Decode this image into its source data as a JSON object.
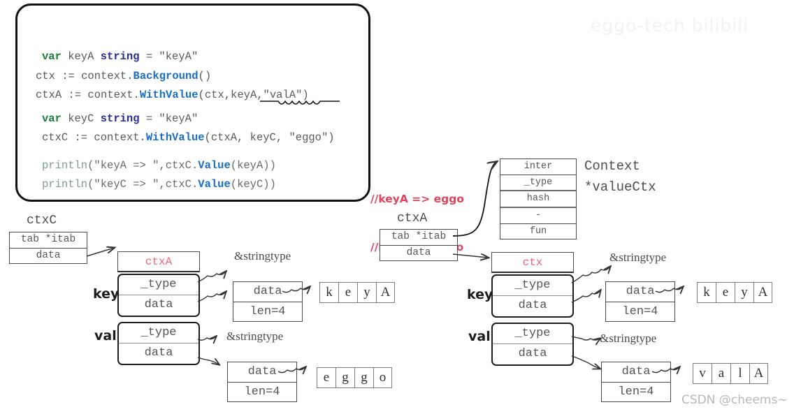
{
  "watermarks": {
    "top": "eggo-tech bilibili",
    "bottom": "CSDN @cheems~"
  },
  "code": {
    "lines": [
      {
        "parts": [
          {
            "t": "var",
            "c": "kw"
          },
          {
            "t": " keyA ",
            "c": ""
          },
          {
            "t": "string",
            "c": "ty"
          },
          {
            "t": " = \"keyA\"",
            "c": ""
          }
        ],
        "indent": true
      },
      {
        "parts": [
          {
            "t": "ctx := context.",
            "c": ""
          },
          {
            "t": "Background",
            "c": "fn"
          },
          {
            "t": "()",
            "c": ""
          }
        ],
        "indent": false
      },
      {
        "parts": [
          {
            "t": "ctxA := context.",
            "c": ""
          },
          {
            "t": "WithValue",
            "c": "fn"
          },
          {
            "t": "(ctx,keyA,\"valA\")",
            "c": ""
          }
        ],
        "indent": false
      },
      {
        "parts": [
          {
            "t": "var",
            "c": "kw"
          },
          {
            "t": " keyC ",
            "c": ""
          },
          {
            "t": "string",
            "c": "ty"
          },
          {
            "t": " = \"keyA\"",
            "c": ""
          }
        ],
        "indent": true
      },
      {
        "parts": [
          {
            "t": "ctxC := context.",
            "c": ""
          },
          {
            "t": "WithValue",
            "c": "fn"
          },
          {
            "t": "(ctxA, keyC, \"eggo\")",
            "c": ""
          }
        ],
        "indent": true
      },
      {
        "parts": [
          {
            "t": "println",
            "c": "pl"
          },
          {
            "t": "(\"keyA => \",ctxC.",
            "c": "pt"
          },
          {
            "t": "Value",
            "c": "fn"
          },
          {
            "t": "(keyA))",
            "c": "pt"
          }
        ],
        "indent": true
      },
      {
        "parts": [
          {
            "t": "println",
            "c": "pl"
          },
          {
            "t": "(\"keyC => \",ctxC.",
            "c": "pt"
          },
          {
            "t": "Value",
            "c": "fn"
          },
          {
            "t": "(keyC))",
            "c": "pt"
          }
        ],
        "indent": true
      }
    ]
  },
  "annotation": {
    "line1": "//keyA => eggo",
    "line2": "//keyC => eggo"
  },
  "left": {
    "iface_caption": "ctxC",
    "iface_rows": [
      "tab *itab",
      "data"
    ],
    "valuectx_header": "ctx'A",
    "valuectx_header_text": "ctxA",
    "key_label": "key",
    "val_label": "val",
    "key_rows": [
      "_type",
      "data"
    ],
    "val_rows": [
      "_type",
      "data"
    ],
    "key_stringtype": "&stringtype",
    "val_stringtype": "&stringtype",
    "key_datalen": [
      "data",
      "len=4"
    ],
    "val_datalen": [
      "data",
      "len=4"
    ],
    "key_chars": [
      "k",
      "e",
      "y",
      "A"
    ],
    "val_chars": [
      "e",
      "g",
      "g",
      "o"
    ]
  },
  "right": {
    "iface_caption": "ctxA",
    "iface_rows": [
      "tab *itab",
      "data"
    ],
    "itab_rows": [
      "inter",
      "_type",
      "hash",
      "-",
      "fun"
    ],
    "itab_label_line1": "Context",
    "itab_label_line2": "*valueCtx",
    "valuectx_header_text": "ctx",
    "key_label": "key",
    "val_label": "val",
    "key_rows": [
      "_type",
      "data"
    ],
    "val_rows": [
      "_type",
      "data"
    ],
    "key_stringtype": "&stringtype",
    "val_stringtype": "&stringtype",
    "key_datalen": [
      "data",
      "len=4"
    ],
    "val_datalen": [
      "data",
      "len=4"
    ],
    "key_chars": [
      "k",
      "e",
      "y",
      "A"
    ],
    "val_chars": [
      "v",
      "a",
      "l",
      "A"
    ]
  },
  "colors": {
    "accent_red": "#e0435c",
    "header_pink": "#e8677e",
    "keyword_green": "#1e7a3c",
    "type_blue": "#2b2b9c",
    "func_blue": "#1a6fc4",
    "box_gray": "#4a4a4a"
  }
}
